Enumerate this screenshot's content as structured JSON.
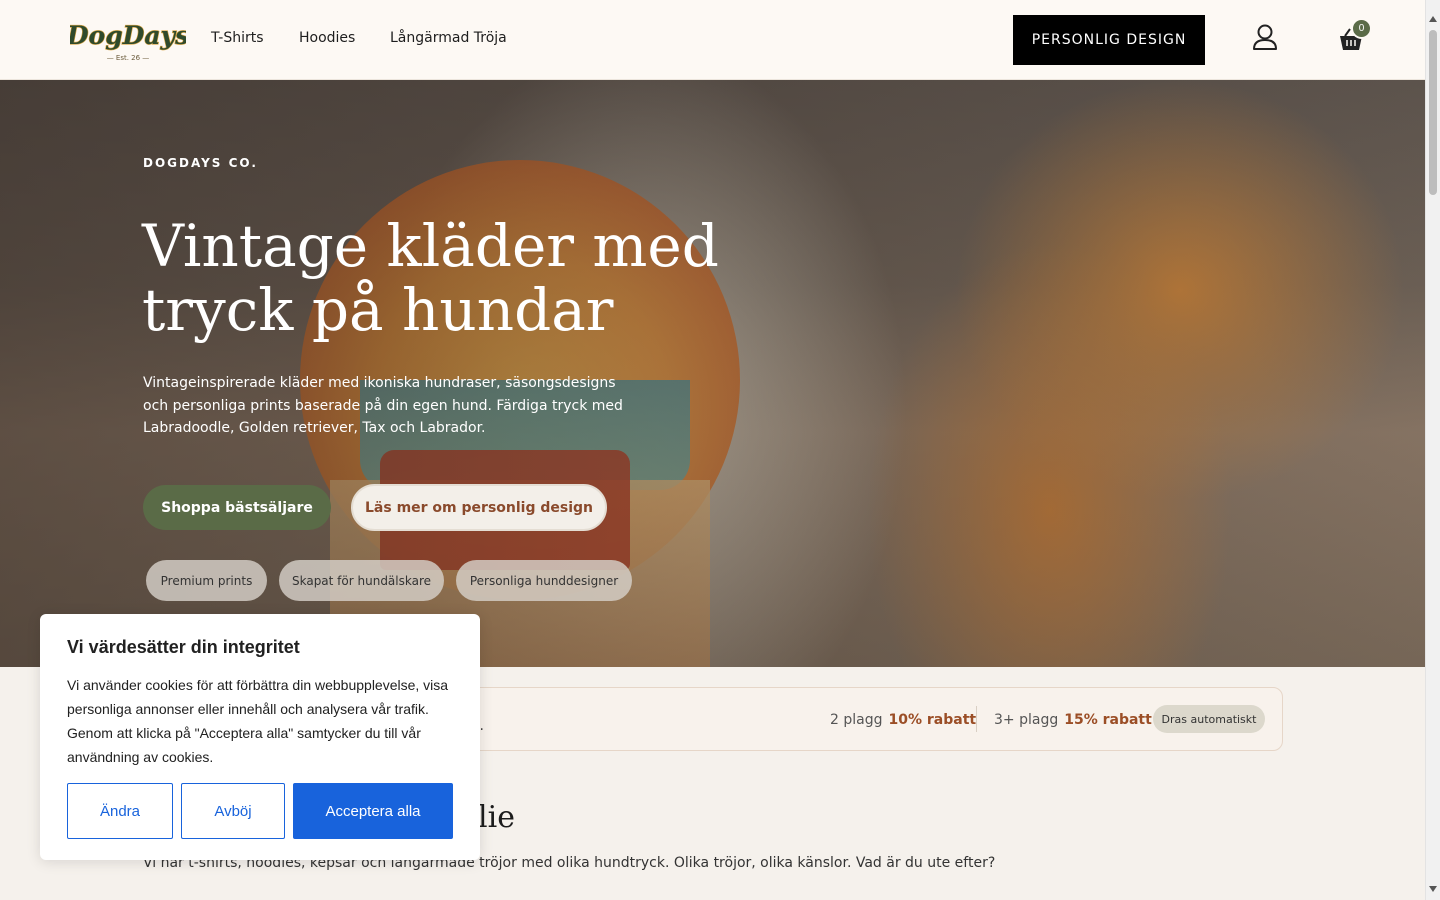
{
  "header": {
    "logo_text": "DogDays",
    "logo_est": "Est. 26",
    "nav": [
      "T-Shirts",
      "Hoodies",
      "Långärmad Tröja"
    ],
    "cta_label": "PERSONLIG DESIGN",
    "cart_count": "0"
  },
  "hero": {
    "eyebrow": "DOGDAYS CO.",
    "title": "Vintage kläder med tryck på hundar",
    "description": "Vintageinspirerade kläder med ikoniska hundraser, säsongsdesigns och personliga prints baserade på din egen hund. Färdiga tryck med Labradoodle, Golden retriever, Tax och Labrador.",
    "primary_button": "Shoppa bästsäljare",
    "secondary_button": "Läs mer om personlig design",
    "pills": [
      "Premium prints",
      "Skapat för hundälskare",
      "Personliga hunddesigner"
    ]
  },
  "discount": {
    "left_text_fragment": "t.",
    "tier1_label": "2 plagg",
    "tier1_value": "10% rabatt",
    "tier2_label": "3+ plagg",
    "tier2_value": "15% rabatt",
    "badge": "Dras automatiskt"
  },
  "section": {
    "title_fragment": "lie",
    "description": "Vi har t-shirts, hoodies, kepsar och långärmade tröjor med olika hundtryck. Olika tröjor, olika känslor. Vad är du ute efter?"
  },
  "cookie": {
    "title": "Vi värdesätter din integritet",
    "text": "Vi använder cookies för att förbättra din webbupplevelse, visa personliga annonser eller innehåll och analysera vår trafik. Genom att klicka på \"Acceptera alla\" samtycker du till vår användning av cookies.",
    "btn_change": "Ändra",
    "btn_reject": "Avböj",
    "btn_accept": "Acceptera alla"
  },
  "colors": {
    "accent_green": "#5a6b47",
    "accent_rust": "#9b4e26",
    "cookie_blue": "#1863dc",
    "header_bg": "#fdf9f4"
  }
}
